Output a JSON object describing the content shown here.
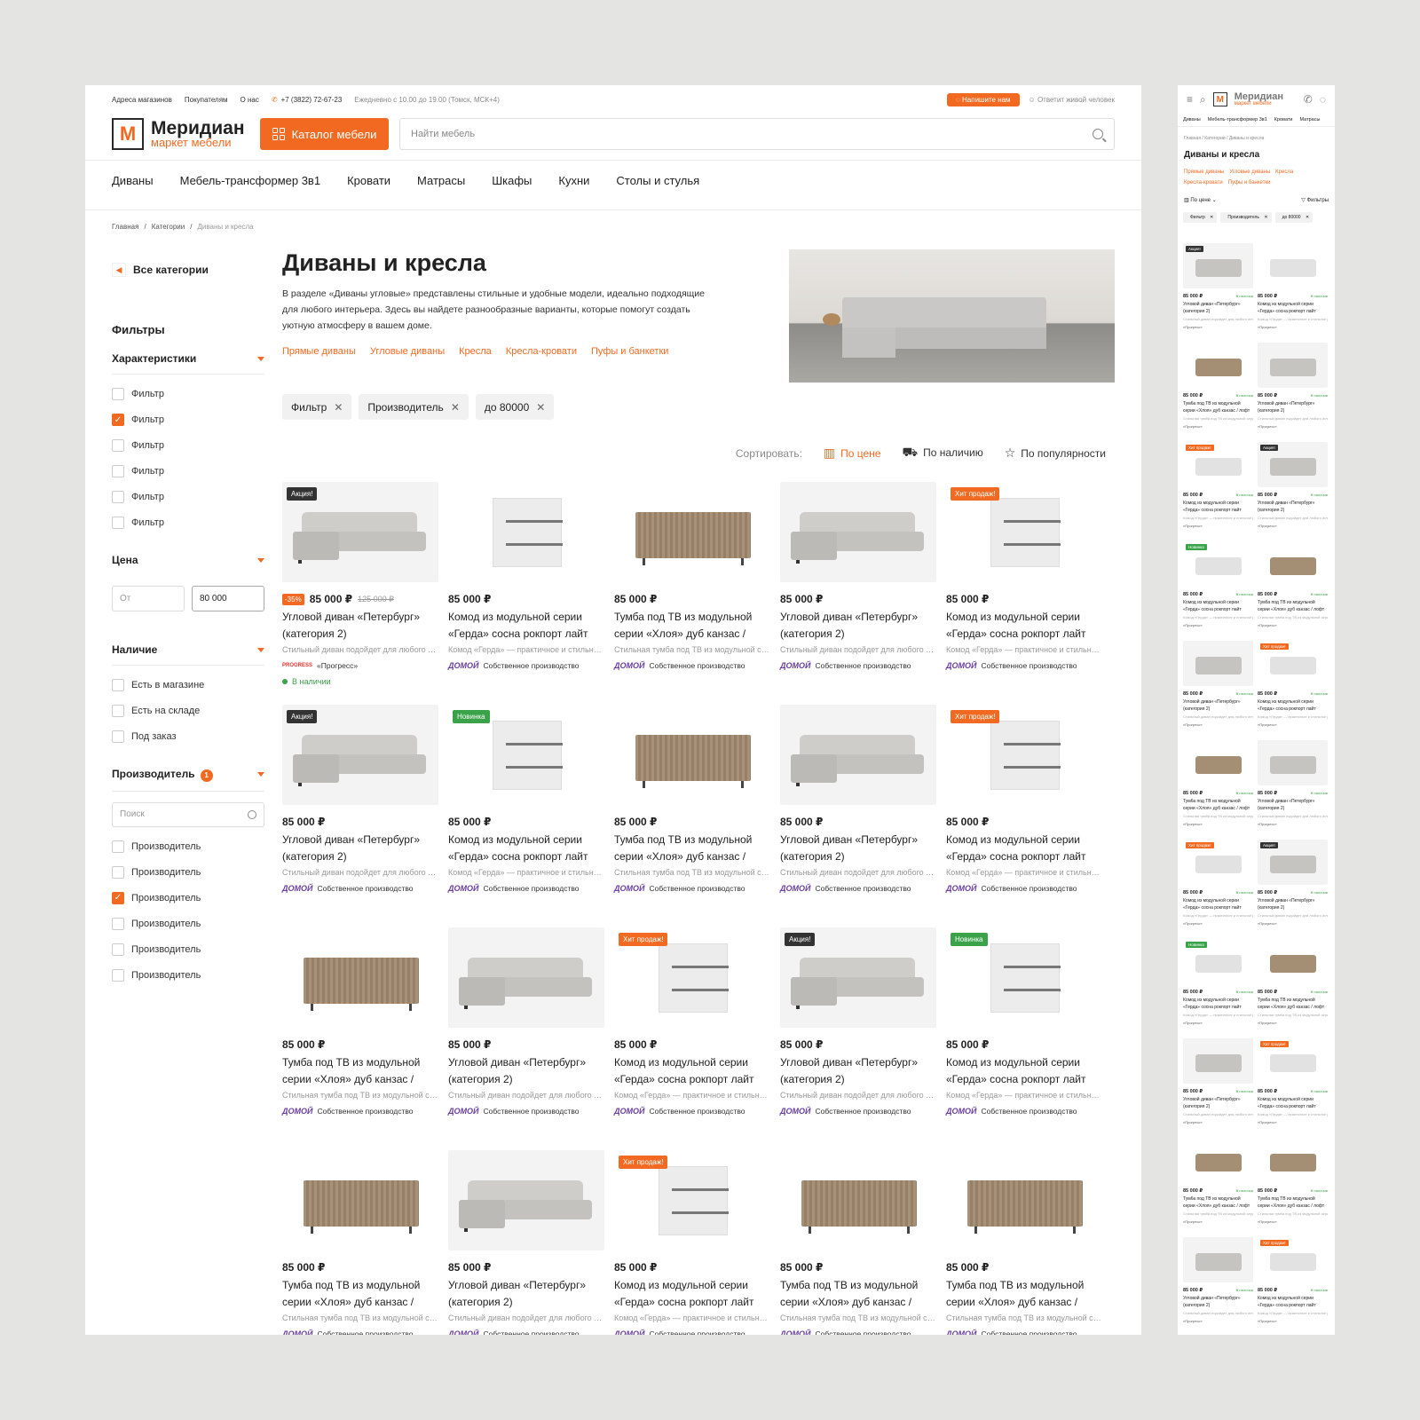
{
  "topbar": {
    "links": [
      "Адреса магазинов",
      "Покупателям",
      "О нас"
    ],
    "phone": "+7 (3822) 72-67-23",
    "hours": "Ежедневно с 10.00 до 19.00 (Томск, МСК+4)",
    "write_label": "Напишите нам",
    "live_label": "Ответит живой человек"
  },
  "header": {
    "logo_letter": "М",
    "logo_name": "Меридиан",
    "logo_tag": "маркет мебели",
    "catalog_label": "Каталог мебели",
    "search_placeholder": "Найти мебель"
  },
  "nav": [
    "Диваны",
    "Мебель-трансформер 3в1",
    "Кровати",
    "Матрасы",
    "Шкафы",
    "Кухни",
    "Столы и стулья"
  ],
  "breadcrumbs": [
    "Главная",
    "Категории",
    "Диваны и кресла"
  ],
  "sidebar": {
    "all_categories": "Все категории",
    "filters_title": "Фильтры",
    "characteristics": {
      "title": "Характеристики",
      "items": [
        {
          "label": "Фильтр",
          "checked": false
        },
        {
          "label": "Фильтр",
          "checked": true
        },
        {
          "label": "Фильтр",
          "checked": false
        },
        {
          "label": "Фильтр",
          "checked": false
        },
        {
          "label": "Фильтр",
          "checked": false
        },
        {
          "label": "Фильтр",
          "checked": false
        }
      ]
    },
    "price": {
      "title": "Цена",
      "from_placeholder": "От",
      "to_value": "80 000"
    },
    "availability": {
      "title": "Наличие",
      "items": [
        {
          "label": "Есть в магазине",
          "checked": false
        },
        {
          "label": "Есть на складе",
          "checked": false
        },
        {
          "label": "Под заказ",
          "checked": false
        }
      ]
    },
    "manufacturer": {
      "title": "Производитель",
      "count": "1",
      "search_placeholder": "Поиск",
      "items": [
        {
          "label": "Производитель",
          "checked": false
        },
        {
          "label": "Производитель",
          "checked": false
        },
        {
          "label": "Производитель",
          "checked": true
        },
        {
          "label": "Производитель",
          "checked": false
        },
        {
          "label": "Производитель",
          "checked": false
        },
        {
          "label": "Производитель",
          "checked": false
        }
      ]
    }
  },
  "page": {
    "title": "Диваны и кресла",
    "description": "В разделе «Диваны угловые» представлены стильные и удобные модели, идеально подходящие для любого интерьера. Здесь вы найдете разнообразные варианты, которые помогут создать уютную атмосферу в вашем доме.",
    "category_links": [
      "Прямые диваны",
      "Угловые диваны",
      "Кресла",
      "Кресла-кровати",
      "Пуфы и банкетки"
    ],
    "chips": [
      "Фильтр",
      "Производитель",
      "до 80000"
    ],
    "sort_label": "Сортировать:",
    "sort_options": [
      "По цене",
      "По наличию",
      "По популярности"
    ]
  },
  "product_types": {
    "sofa": {
      "name": "Угловой диван «Петербург» (категория 2)",
      "desc": "Стильный диван подойдет для любого интерьера"
    },
    "dresser": {
      "name": "Комод из модульной серии «Герда» сосна рокпорт лайт",
      "desc": "Комод «Герда» — практичное и стильное решение"
    },
    "tv": {
      "name": "Тумба под ТВ из модульной серии «Хлоя» дуб канзас / лофт",
      "desc": "Стильная тумба под ТВ из модульной серии"
    }
  },
  "maker": {
    "domoy_logo": "ДОМОЙ",
    "domoy": "Собственное производство",
    "progress_logo": "PROGRESS",
    "progress": "«Прогресс»"
  },
  "stock_label": "В наличии",
  "products": [
    {
      "type": "sofa",
      "price": "85 000 ₽",
      "tag": "Акция!",
      "tag_style": "dark",
      "discount": "-35%",
      "old_price": "125 000 ₽",
      "maker": "progress",
      "in_stock": true
    },
    {
      "type": "dresser",
      "price": "85 000 ₽",
      "tag": "",
      "tag_style": "",
      "maker": "domoy"
    },
    {
      "type": "tv",
      "price": "85 000 ₽",
      "tag": "",
      "tag_style": "",
      "maker": "domoy"
    },
    {
      "type": "sofa",
      "price": "85 000 ₽",
      "tag": "",
      "tag_style": "",
      "maker": "domoy"
    },
    {
      "type": "dresser",
      "price": "85 000 ₽",
      "tag": "Хит продаж!",
      "tag_style": "red",
      "maker": "domoy"
    },
    {
      "type": "sofa",
      "price": "85 000 ₽",
      "tag": "Акция!",
      "tag_style": "dark",
      "maker": "domoy"
    },
    {
      "type": "dresser",
      "price": "85 000 ₽",
      "tag": "Новинка",
      "tag_style": "green",
      "maker": "domoy"
    },
    {
      "type": "tv",
      "price": "85 000 ₽",
      "tag": "",
      "tag_style": "",
      "maker": "domoy"
    },
    {
      "type": "sofa",
      "price": "85 000 ₽",
      "tag": "",
      "tag_style": "",
      "maker": "domoy"
    },
    {
      "type": "dresser",
      "price": "85 000 ₽",
      "tag": "Хит продаж!",
      "tag_style": "red",
      "maker": "domoy"
    },
    {
      "type": "tv",
      "price": "85 000 ₽",
      "tag": "",
      "tag_style": "",
      "maker": "domoy"
    },
    {
      "type": "sofa",
      "price": "85 000 ₽",
      "tag": "",
      "tag_style": "",
      "maker": "domoy"
    },
    {
      "type": "dresser",
      "price": "85 000 ₽",
      "tag": "Хит продаж!",
      "tag_style": "red",
      "maker": "domoy"
    },
    {
      "type": "sofa",
      "price": "85 000 ₽",
      "tag": "Акция!",
      "tag_style": "dark",
      "maker": "domoy"
    },
    {
      "type": "dresser",
      "price": "85 000 ₽",
      "tag": "Новинка",
      "tag_style": "green",
      "maker": "domoy"
    },
    {
      "type": "tv",
      "price": "85 000 ₽",
      "tag": "",
      "tag_style": "",
      "maker": "domoy"
    },
    {
      "type": "sofa",
      "price": "85 000 ₽",
      "tag": "",
      "tag_style": "",
      "maker": "domoy"
    },
    {
      "type": "dresser",
      "price": "85 000 ₽",
      "tag": "Хит продаж!",
      "tag_style": "red",
      "maker": "domoy"
    },
    {
      "type": "tv",
      "price": "85 000 ₽",
      "tag": "",
      "tag_style": "",
      "maker": "domoy"
    },
    {
      "type": "tv",
      "price": "85 000 ₽",
      "tag": "",
      "tag_style": "",
      "maker": "domoy"
    }
  ],
  "mobile": {
    "nav": [
      "Диваны",
      "Мебель-трансформер 3в1",
      "Кровати",
      "Матрасы"
    ],
    "sort_label": "По цене",
    "filters_label": "Фильтры",
    "chips": [
      "Фильтр",
      "Производитель",
      "до 80000"
    ],
    "stock_label": "В наличии",
    "products": [
      {
        "type": "sofa",
        "tag": "Акция!",
        "tag_style": "dark"
      },
      {
        "type": "dresser",
        "tag": "",
        "tag_style": ""
      },
      {
        "type": "tv",
        "tag": "",
        "tag_style": ""
      },
      {
        "type": "sofa",
        "tag": "",
        "tag_style": ""
      },
      {
        "type": "dresser",
        "tag": "Хит продаж!",
        "tag_style": "red"
      },
      {
        "type": "sofa",
        "tag": "Акция!",
        "tag_style": "dark"
      },
      {
        "type": "dresser",
        "tag": "Новинка",
        "tag_style": "green"
      },
      {
        "type": "tv",
        "tag": "",
        "tag_style": ""
      },
      {
        "type": "sofa",
        "tag": "",
        "tag_style": ""
      },
      {
        "type": "dresser",
        "tag": "Хит продаж!",
        "tag_style": "red"
      },
      {
        "type": "tv",
        "tag": "",
        "tag_style": ""
      },
      {
        "type": "sofa",
        "tag": "",
        "tag_style": ""
      },
      {
        "type": "dresser",
        "tag": "Хит продаж!",
        "tag_style": "red"
      },
      {
        "type": "sofa",
        "tag": "Акция!",
        "tag_style": "dark"
      },
      {
        "type": "dresser",
        "tag": "Новинка",
        "tag_style": "green"
      },
      {
        "type": "tv",
        "tag": "",
        "tag_style": ""
      },
      {
        "type": "sofa",
        "tag": "",
        "tag_style": ""
      },
      {
        "type": "dresser",
        "tag": "Хит продаж!",
        "tag_style": "red"
      },
      {
        "type": "tv",
        "tag": "",
        "tag_style": ""
      },
      {
        "type": "tv",
        "tag": "",
        "tag_style": ""
      },
      {
        "type": "sofa",
        "tag": "",
        "tag_style": ""
      },
      {
        "type": "dresser",
        "tag": "Хит продаж!",
        "tag_style": "red"
      }
    ]
  },
  "colors": {
    "accent": "#f26a21",
    "green": "#3aa34a",
    "dark": "#333333"
  }
}
